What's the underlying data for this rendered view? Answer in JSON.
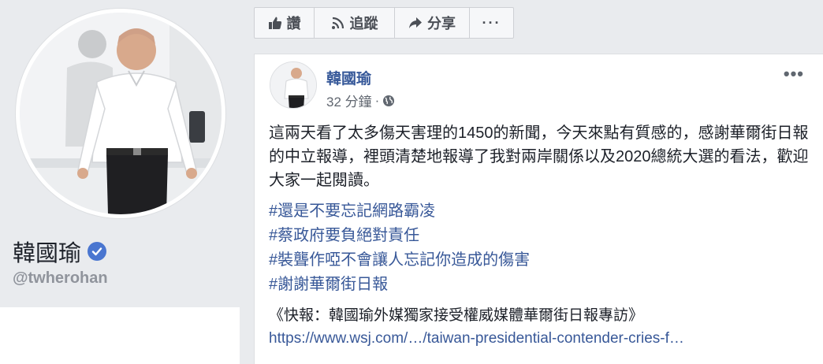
{
  "profile": {
    "name": "韓國瑜",
    "handle": "@twherohan"
  },
  "actions": {
    "like_label": "讚",
    "follow_label": "追蹤",
    "share_label": "分享",
    "more_label": "···"
  },
  "post": {
    "author": "韓國瑜",
    "time": "32 分鐘",
    "separator": "·",
    "options_label": "•••",
    "text": "這兩天看了太多傷天害理的1450的新聞，今天來點有質感的，感謝華爾街日報的中立報導，裡頭清楚地報導了我對兩岸關係以及2020總統大選的看法，歡迎大家一起閱讀。",
    "hashtags": [
      "#還是不要忘記網路霸凌",
      "#蔡政府要負絕對責任",
      "#裝聾作啞不會讓人忘記你造成的傷害",
      "#謝謝華爾街日報"
    ],
    "link_title": "《快報：韓國瑜外媒獨家接受權威媒體華爾街日報專訪》",
    "link_url": "https://www.wsj.com/…/taiwan-presidential-contender-cries-f…"
  },
  "colors": {
    "link": "#385898",
    "verified": "#4a76d0",
    "page_bg": "#e9ebee"
  },
  "icons": [
    "like-icon",
    "rss-icon",
    "share-arrow-icon",
    "verified-badge-icon",
    "globe-icon",
    "more-options-icon"
  ]
}
